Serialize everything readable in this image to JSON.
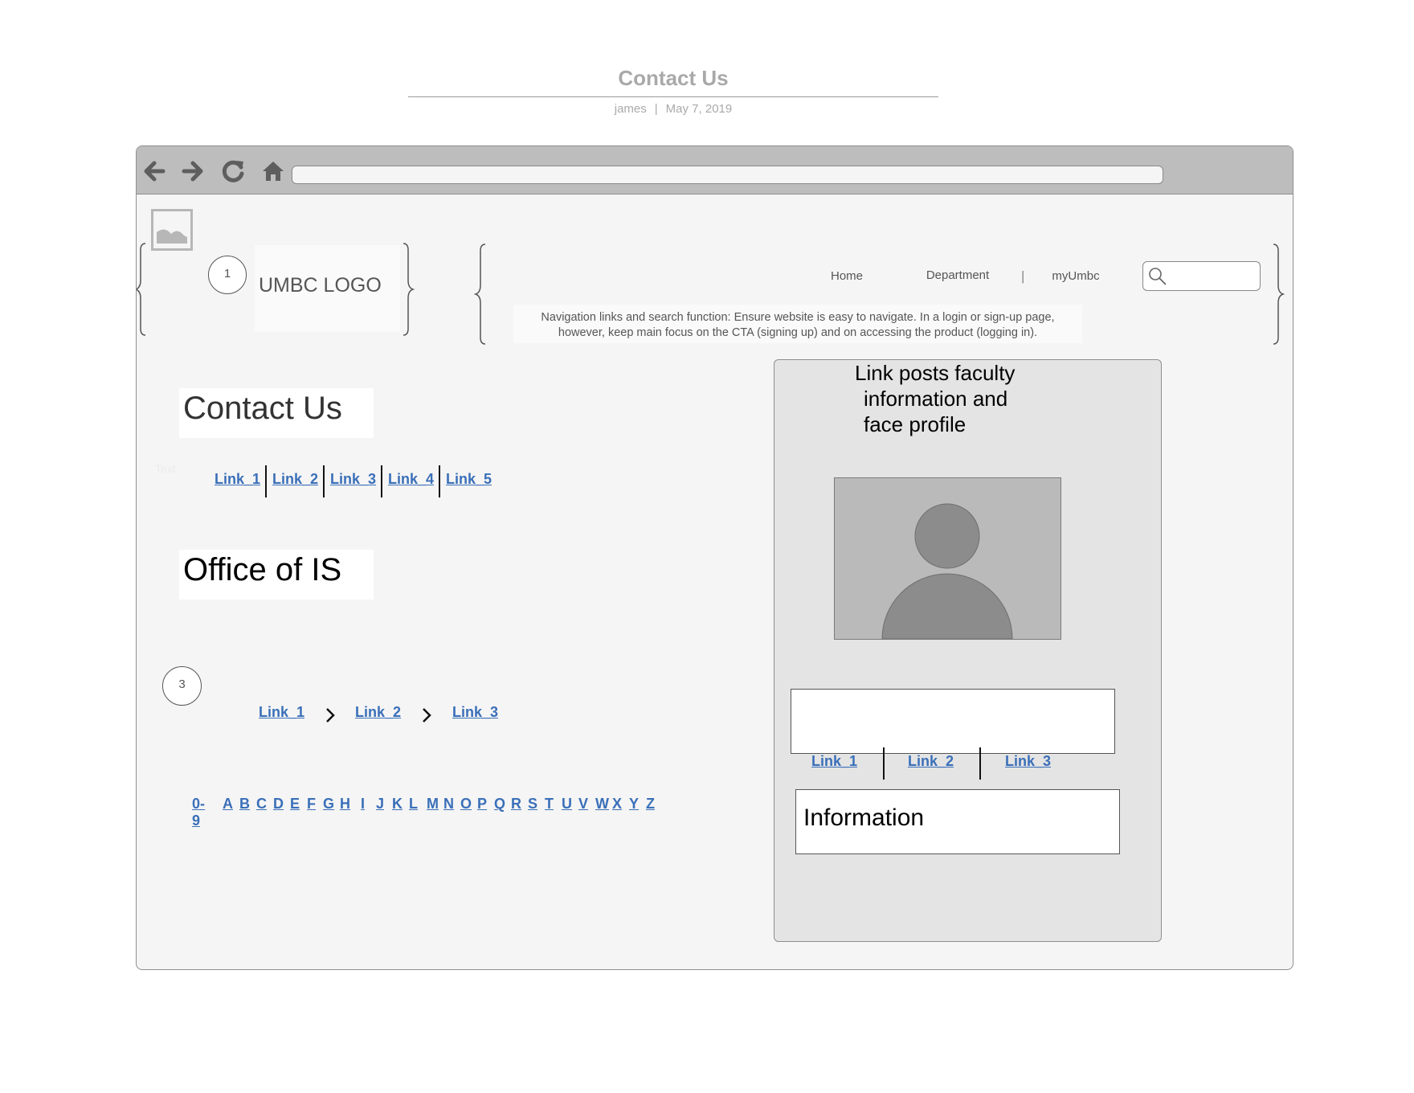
{
  "document": {
    "title": "Contact Us",
    "author": "james",
    "separator": "|",
    "date": "May 7, 2019"
  },
  "browser": {
    "toolbar": {
      "back_icon": "arrow-left-icon",
      "forward_icon": "arrow-right-icon",
      "reload_icon": "reload-icon",
      "home_icon": "home-icon",
      "url": ""
    }
  },
  "header": {
    "image_placeholder_icon": "image-icon",
    "badge_1": "1",
    "logo_text": "UMBC LOGO",
    "nav": {
      "home": "Home",
      "department": "Department",
      "divider": "|",
      "myumbc": "myUmbc"
    },
    "search": {
      "icon": "search-icon",
      "value": ""
    },
    "nav_note": "Navigation links and search function: Ensure website is easy to navigate. In a login or sign-up page, however, keep main focus on the CTA (signing up) and on accessing the product (logging in)."
  },
  "main": {
    "contact_heading": "Contact Us",
    "ghost_text": "Text",
    "link_bar": [
      "Link_1",
      "Link_2",
      "Link_3",
      "Link_4",
      "Link_5"
    ],
    "office_heading": "Office of IS",
    "badge_3": "3",
    "breadcrumb": [
      "Link_1",
      "Link_2",
      "Link_3"
    ],
    "breadcrumb_separator_icon": "chevron-right-icon",
    "alphabet": [
      "0-9",
      "A",
      "B",
      "C",
      "D",
      "E",
      "F",
      "G",
      "H",
      "I",
      "J",
      "K",
      "L",
      "M",
      "N",
      "O",
      "P",
      "Q",
      "R",
      "S",
      "T",
      "U",
      "V",
      "W",
      "X",
      "Y",
      "Z"
    ]
  },
  "panel": {
    "caption": [
      "Link posts faculty",
      "information and",
      "face profile"
    ],
    "profile_icon": "user-avatar-icon",
    "links": [
      "Link_1",
      "Link_2",
      "Link_3"
    ],
    "information": "Information"
  },
  "colors": {
    "link": "#3a6fb8",
    "toolbar": "#bdbdbd",
    "browser_bg": "#f5f5f5",
    "panel_bg": "#e4e4e4",
    "avatar_bg": "#bababa",
    "avatar_fill": "#8c8c8c"
  }
}
